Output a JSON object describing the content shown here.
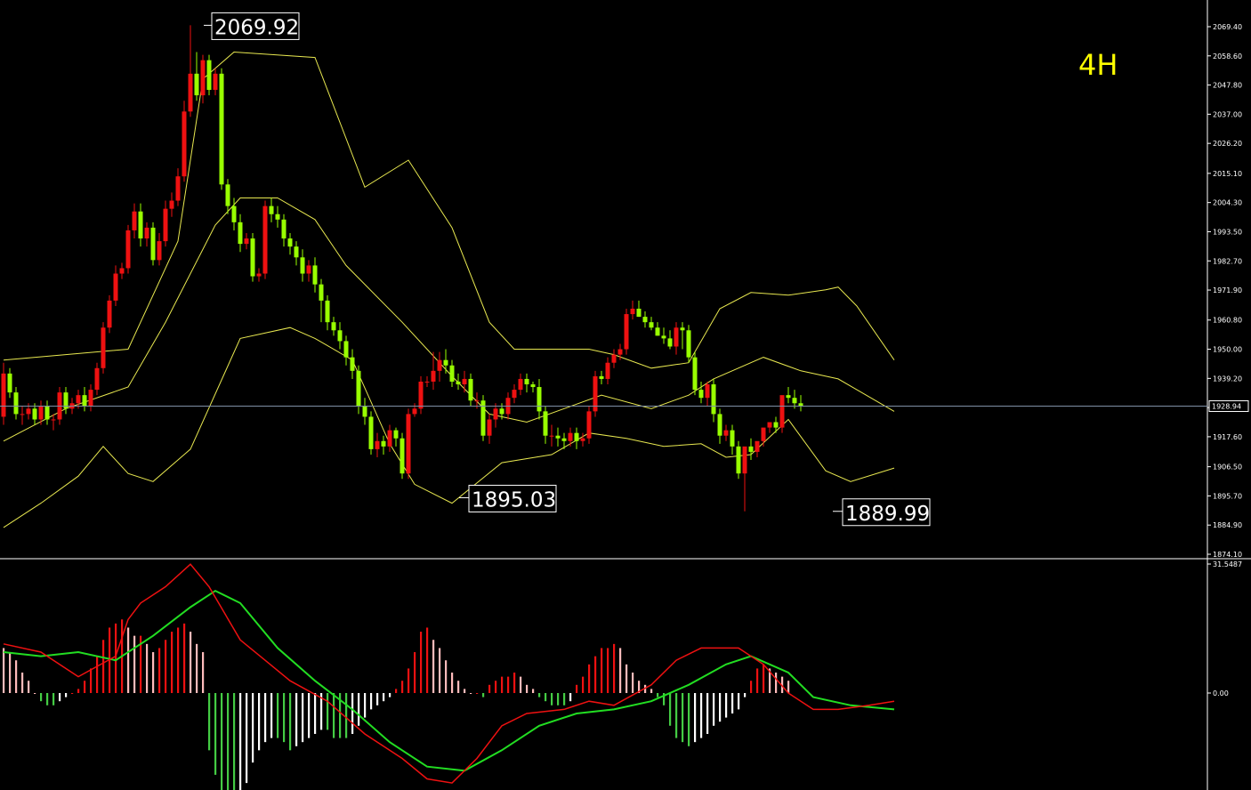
{
  "timeframe": "4H",
  "chart_data": [
    {
      "type": "candlestick",
      "indicators": [
        "Bollinger Bands"
      ],
      "ylim": [
        1874.1,
        2075.0
      ],
      "yticks": [
        "2069.40",
        "2058.60",
        "2047.80",
        "2037.00",
        "2026.20",
        "2015.10",
        "2004.30",
        "1993.50",
        "1982.70",
        "1971.90",
        "1960.80",
        "1950.00",
        "1939.20",
        "1928.40",
        "1917.60",
        "1906.50",
        "1895.70",
        "1884.90",
        "1874.10"
      ],
      "current_price": "1928.94",
      "annotations": [
        {
          "label": "2069.92",
          "x": 32,
          "value": 2069.92,
          "side": "high"
        },
        {
          "label": "1895.03",
          "x": 73,
          "value": 1895.03,
          "side": "low"
        },
        {
          "label": "1889.99",
          "x": 133,
          "value": 1889.99,
          "side": "low"
        }
      ],
      "x": [
        0,
        1,
        2,
        3,
        4,
        5,
        6,
        7,
        8,
        9,
        10,
        11,
        12,
        13,
        14,
        15,
        16,
        17,
        18,
        19,
        20,
        21,
        22,
        23,
        24,
        25,
        26,
        27,
        28,
        29,
        30,
        31,
        32,
        33,
        34,
        35,
        36,
        37,
        38,
        39,
        40,
        41,
        42,
        43,
        44,
        45,
        46,
        47,
        48,
        49,
        50,
        51,
        52,
        53,
        54,
        55,
        56,
        57,
        58,
        59,
        60,
        61,
        62,
        63,
        64,
        65,
        66,
        67,
        68,
        69,
        70,
        71,
        72,
        73,
        74,
        75,
        76,
        77,
        78,
        79,
        80,
        81,
        82,
        83,
        84,
        85,
        86,
        87,
        88,
        89,
        90,
        91,
        92,
        93,
        94,
        95,
        96,
        97,
        98,
        99,
        100,
        101,
        102,
        103,
        104,
        105,
        106,
        107,
        108,
        109,
        110,
        111,
        112,
        113,
        114,
        115,
        116,
        117,
        118,
        119,
        120,
        121,
        122,
        123,
        124,
        125,
        126,
        127,
        128,
        129,
        130,
        131,
        132,
        133,
        134,
        135,
        136,
        137,
        138,
        139,
        140,
        141,
        142,
        143
      ],
      "open": [
        1925,
        1941,
        1934,
        1926,
        1926,
        1928,
        1924,
        1929,
        1924,
        1924,
        1934,
        1928,
        1930,
        1933,
        1929,
        1935,
        1943,
        1958,
        1968,
        1978,
        1980,
        1994,
        2001,
        1991,
        1995,
        1983,
        1990,
        2002,
        2005,
        2014,
        2038,
        2052,
        2044,
        2057,
        2046,
        2052,
        2011,
        2003,
        1997,
        1989,
        1991,
        1977,
        1978,
        2003,
        2000,
        1998,
        1991,
        1988,
        1984,
        1978,
        1981,
        1974,
        1968,
        1960,
        1957,
        1953,
        1947,
        1942,
        1929,
        1925,
        1913,
        1916,
        1914,
        1920,
        1917,
        1904,
        1926,
        1928,
        1938,
        1938,
        1942,
        1946,
        1944,
        1938,
        1937,
        1939,
        1931,
        1931,
        1918,
        1924,
        1928,
        1926,
        1932,
        1935,
        1939,
        1937,
        1936,
        1927,
        1918,
        1918,
        1917,
        1916,
        1919,
        1916,
        1917,
        1927,
        1940,
        1939,
        1945,
        1948,
        1950,
        1963,
        1965,
        1962,
        1960,
        1958,
        1955,
        1954,
        1951,
        1958,
        1957,
        1947,
        1935,
        1932,
        1937,
        1926,
        1918,
        1920,
        1914,
        1904,
        1914,
        1912,
        1916,
        1921,
        1923,
        1921,
        1933,
        1932,
        1930
      ],
      "close": [
        1941,
        1934,
        1926,
        1926,
        1928,
        1924,
        1929,
        1924,
        1924,
        1934,
        1928,
        1930,
        1933,
        1929,
        1935,
        1943,
        1958,
        1968,
        1978,
        1980,
        1994,
        2001,
        1991,
        1995,
        1983,
        1990,
        2002,
        2005,
        2014,
        2038,
        2052,
        2044,
        2057,
        2046,
        2052,
        2011,
        2003,
        1997,
        1989,
        1991,
        1977,
        1978,
        2003,
        2000,
        1998,
        1991,
        1988,
        1984,
        1978,
        1981,
        1974,
        1968,
        1960,
        1957,
        1953,
        1947,
        1942,
        1929,
        1925,
        1913,
        1916,
        1914,
        1920,
        1917,
        1904,
        1926,
        1928,
        1938,
        1938,
        1942,
        1946,
        1944,
        1938,
        1937,
        1939,
        1931,
        1931,
        1918,
        1924,
        1928,
        1926,
        1932,
        1935,
        1939,
        1937,
        1936,
        1927,
        1918,
        1918,
        1917,
        1916,
        1919,
        1916,
        1917,
        1927,
        1940,
        1939,
        1945,
        1948,
        1950,
        1963,
        1965,
        1962,
        1960,
        1958,
        1955,
        1954,
        1951,
        1958,
        1957,
        1947,
        1935,
        1932,
        1937,
        1926,
        1918,
        1920,
        1914,
        1904,
        1914,
        1912,
        1916,
        1921,
        1923,
        1921,
        1933,
        1932,
        1930,
        1928.94
      ],
      "high": [
        1945,
        1943,
        1936,
        1929,
        1930,
        1930,
        1931,
        1931,
        1926,
        1936,
        1936,
        1932,
        1935,
        1936,
        1937,
        1945,
        1960,
        1970,
        1981,
        1982,
        1996,
        2004,
        2004,
        1997,
        1997,
        1993,
        2005,
        2008,
        2017,
        2042,
        2069.92,
        2060,
        2059,
        2059,
        2054,
        2054,
        2013,
        2006,
        2000,
        1993,
        1993,
        1980,
        2005,
        2006,
        2003,
        2000,
        1993,
        1990,
        1987,
        1983,
        1984,
        1976,
        1970,
        1962,
        1960,
        1955,
        1950,
        1944,
        1932,
        1927,
        1919,
        1918,
        1922,
        1921,
        1919,
        1928,
        1930,
        1940,
        1940,
        1949,
        1949,
        1950,
        1946,
        1941,
        1942,
        1941,
        1934,
        1933,
        1926,
        1930,
        1930,
        1934,
        1937,
        1941,
        1941,
        1938,
        1939,
        1929,
        1922,
        1921,
        1919,
        1921,
        1921,
        1919,
        1929,
        1942,
        1942,
        1947,
        1950,
        1952,
        1965,
        1968,
        1968,
        1964,
        1962,
        1960,
        1958,
        1957,
        1960,
        1960,
        1959,
        1949,
        1938,
        1938,
        1939,
        1928,
        1922,
        1922,
        1916,
        1913,
        1917,
        1915,
        1918,
        1923,
        1925,
        1925,
        1936,
        1935,
        1933
      ],
      "low": [
        1922,
        1932,
        1924,
        1922,
        1924,
        1922,
        1922,
        1922,
        1920,
        1922,
        1926,
        1926,
        1928,
        1927,
        1927,
        1933,
        1941,
        1956,
        1966,
        1976,
        1978,
        1991,
        1988,
        1988,
        1981,
        1981,
        1988,
        1999,
        2003,
        2012,
        2036,
        2042,
        2041,
        2044,
        2044,
        2009,
        2000,
        1994,
        1986,
        1987,
        1975,
        1975,
        1976,
        1997,
        1995,
        1988,
        1985,
        1981,
        1975,
        1975,
        1971,
        1960,
        1957,
        1955,
        1950,
        1944,
        1939,
        1926,
        1922,
        1911,
        1910,
        1911,
        1912,
        1914,
        1902,
        1902,
        1925,
        1926,
        1936,
        1935,
        1938,
        1941,
        1936,
        1935,
        1934,
        1929,
        1928,
        1916,
        1915,
        1921,
        1924,
        1924,
        1930,
        1933,
        1934,
        1934,
        1924,
        1915,
        1914,
        1914,
        1913,
        1914,
        1913,
        1914,
        1915,
        1925,
        1937,
        1937,
        1943,
        1946,
        1948,
        1961,
        1962,
        1958,
        1957,
        1955,
        1952,
        1950,
        1948,
        1950,
        1945,
        1933,
        1930,
        1929,
        1923,
        1915,
        1916,
        1911,
        1902,
        1889.99,
        1909,
        1910,
        1914,
        1919,
        1919,
        1919,
        1930,
        1928,
        1927
      ],
      "bands": {
        "upper": [
          [
            0,
            1946
          ],
          [
            20,
            1950
          ],
          [
            28,
            1990
          ],
          [
            32,
            2050
          ],
          [
            37,
            2060
          ],
          [
            50,
            2058
          ],
          [
            58,
            2010
          ],
          [
            65,
            2020
          ],
          [
            72,
            1995
          ],
          [
            78,
            1960
          ],
          [
            82,
            1950
          ],
          [
            94,
            1950
          ],
          [
            98,
            1948
          ],
          [
            104,
            1943
          ],
          [
            110,
            1945
          ],
          [
            115,
            1965
          ],
          [
            120,
            1971
          ],
          [
            126,
            1970
          ],
          [
            132,
            1972
          ],
          [
            134,
            1973
          ],
          [
            137,
            1966
          ],
          [
            143,
            1946
          ]
        ],
        "middle": [
          [
            0,
            1916
          ],
          [
            10,
            1928
          ],
          [
            20,
            1936
          ],
          [
            26,
            1960
          ],
          [
            34,
            1996
          ],
          [
            38,
            2006
          ],
          [
            44,
            2006
          ],
          [
            50,
            1998
          ],
          [
            55,
            1981
          ],
          [
            64,
            1960
          ],
          [
            72,
            1940
          ],
          [
            78,
            1926
          ],
          [
            84,
            1923
          ],
          [
            96,
            1933
          ],
          [
            104,
            1928
          ],
          [
            110,
            1933
          ],
          [
            114,
            1939
          ],
          [
            122,
            1947
          ],
          [
            128,
            1942
          ],
          [
            134,
            1939
          ],
          [
            137,
            1935
          ],
          [
            143,
            1927
          ]
        ],
        "lower": [
          [
            0,
            1884
          ],
          [
            6,
            1893
          ],
          [
            12,
            1903
          ],
          [
            16,
            1914
          ],
          [
            20,
            1904
          ],
          [
            24,
            1901
          ],
          [
            30,
            1913
          ],
          [
            38,
            1954
          ],
          [
            46,
            1958
          ],
          [
            50,
            1954
          ],
          [
            56,
            1946
          ],
          [
            62,
            1915
          ],
          [
            66,
            1900
          ],
          [
            72,
            1893
          ],
          [
            80,
            1908
          ],
          [
            88,
            1911
          ],
          [
            94,
            1919
          ],
          [
            100,
            1917
          ],
          [
            106,
            1914
          ],
          [
            112,
            1915
          ],
          [
            116,
            1910
          ],
          [
            120,
            1911
          ],
          [
            126,
            1924
          ],
          [
            132,
            1905
          ],
          [
            136,
            1901
          ],
          [
            143,
            1906
          ]
        ]
      }
    },
    {
      "type": "histogram",
      "indicator": "MACD",
      "yticks": [
        "31.5487",
        "0.00"
      ],
      "ylim": [
        -24.0,
        31.5487
      ],
      "histogram": [
        11,
        10,
        8,
        5,
        3,
        0,
        -2,
        -3,
        -3,
        -2,
        -1,
        0,
        1,
        3,
        6,
        9,
        13,
        16,
        17,
        18,
        16,
        14,
        14,
        12,
        10,
        11,
        13,
        15,
        16,
        17,
        15,
        12,
        10,
        -14,
        -20,
        -24,
        -26,
        -27,
        -25,
        -22,
        -17,
        -14,
        -12,
        -11,
        -11,
        -12,
        -14,
        -13,
        -12,
        -11,
        -10,
        -9,
        -9,
        -11,
        -11,
        -11,
        -10,
        -8,
        -6,
        -4,
        -3,
        -2,
        -1,
        1,
        3,
        6,
        10,
        15,
        16,
        13,
        11,
        8,
        5,
        3,
        1,
        0,
        0,
        -1,
        2,
        3,
        4,
        4,
        5,
        4,
        2,
        1,
        -1,
        -2,
        -3,
        -3,
        -3,
        -2,
        2,
        4,
        7,
        9,
        11,
        11,
        12,
        11,
        7,
        5,
        3,
        2,
        1,
        -1,
        -3,
        -8,
        -11,
        -12,
        -13,
        -12,
        -11,
        -10,
        -8,
        -7,
        -6,
        -5,
        -4,
        -1,
        3,
        6,
        7,
        6,
        5,
        4,
        3
      ],
      "macd": [
        [
          0,
          12
        ],
        [
          6,
          10
        ],
        [
          12,
          4
        ],
        [
          18,
          9
        ],
        [
          20,
          18
        ],
        [
          22,
          22
        ],
        [
          26,
          26
        ],
        [
          30,
          31.5
        ],
        [
          33,
          26
        ],
        [
          38,
          13
        ],
        [
          42,
          8
        ],
        [
          46,
          3
        ],
        [
          52,
          -2
        ],
        [
          58,
          -10
        ],
        [
          64,
          -16
        ],
        [
          68,
          -21
        ],
        [
          72,
          -22
        ],
        [
          76,
          -16
        ],
        [
          80,
          -8
        ],
        [
          84,
          -5
        ],
        [
          90,
          -4
        ],
        [
          94,
          -2
        ],
        [
          98,
          -3
        ],
        [
          104,
          2
        ],
        [
          108,
          8
        ],
        [
          112,
          11
        ],
        [
          118,
          11
        ],
        [
          122,
          7
        ],
        [
          126,
          0
        ],
        [
          130,
          -4
        ],
        [
          134,
          -4
        ],
        [
          139,
          -3
        ],
        [
          143,
          -2
        ]
      ],
      "signal": [
        [
          0,
          10
        ],
        [
          6,
          9
        ],
        [
          12,
          10
        ],
        [
          18,
          8
        ],
        [
          24,
          14
        ],
        [
          30,
          21
        ],
        [
          34,
          25
        ],
        [
          38,
          22
        ],
        [
          44,
          11
        ],
        [
          50,
          3
        ],
        [
          56,
          -4
        ],
        [
          62,
          -12
        ],
        [
          68,
          -18
        ],
        [
          74,
          -19
        ],
        [
          80,
          -14
        ],
        [
          86,
          -8
        ],
        [
          92,
          -5
        ],
        [
          98,
          -4
        ],
        [
          104,
          -2
        ],
        [
          110,
          2
        ],
        [
          116,
          7
        ],
        [
          120,
          9
        ],
        [
          126,
          5
        ],
        [
          130,
          -1
        ],
        [
          136,
          -3
        ],
        [
          143,
          -4
        ]
      ]
    }
  ]
}
